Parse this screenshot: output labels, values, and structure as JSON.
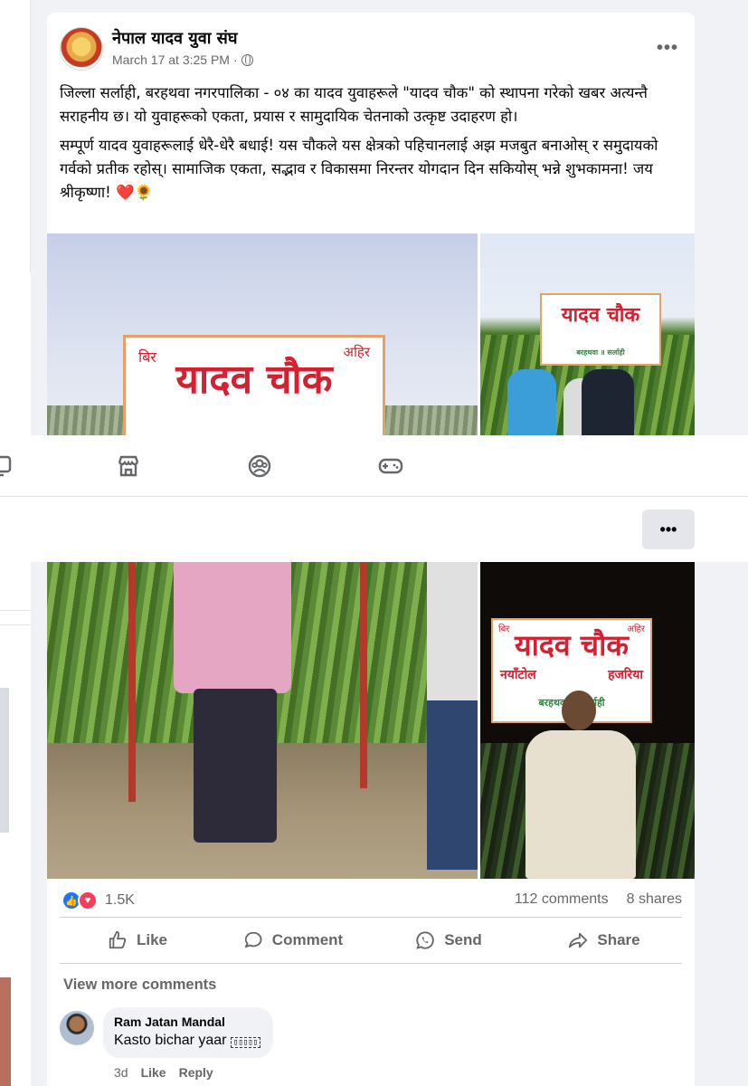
{
  "post": {
    "page_name": "नेपाल यादव युवा संघ",
    "time": "March 17 at 3:25 PM",
    "dot": "·",
    "more": "•••",
    "paragraph1": "जिल्ला सर्लाही, बरहथवा नगरपालिका - ०४ का यादव युवाहरूले \"यादव चौक\" को स्थापना गरेको खबर अत्यन्तै सराहनीय छ। यो युवाहरूको एकता, प्रयास र सामुदायिक चेतनाको उत्कृष्ट उदाहरण हो।",
    "paragraph2": "सम्पूर्ण यादव युवाहरूलाई धेरै-धेरै बधाई! यस चौकले यस क्षेत्रको पहिचानलाई अझ मजबुत बनाओस् र समुदायको गर्वको प्रतीक रहोस्। सामाजिक एकता, सद्भाव र विकासमा निरन्तर योगदान दिन सकियोस् भन्ने शुभकामना! जय श्रीकृष्णा! ❤️🌻"
  },
  "sign": {
    "left_top": "बिर",
    "right_top": "अहिर",
    "title": "यादव चौक",
    "sub_left": "नयाँटोल",
    "sub_right": "हजरिया",
    "bottom": "बरहथवा ॥ सर्लाही"
  },
  "nav": {
    "icons": [
      "monitor-icon",
      "marketplace-icon",
      "groups-icon",
      "gaming-icon"
    ]
  },
  "header2": {
    "more": "•••"
  },
  "stats": {
    "reactions": "1.5K",
    "comments": "112 comments",
    "shares": "8 shares"
  },
  "actions": {
    "like": "Like",
    "comment": "Comment",
    "send": "Send",
    "share": "Share"
  },
  "comments": {
    "view_more": "View more comments",
    "items": [
      {
        "name": "Ram Jatan Mandal",
        "text": "Kasto bichar yaar",
        "time": "3d",
        "like": "Like",
        "reply": "Reply"
      }
    ]
  },
  "colors": {
    "brand_blue": "#1877f2",
    "love_red": "#f33e58",
    "secondary_text": "#65676b"
  }
}
